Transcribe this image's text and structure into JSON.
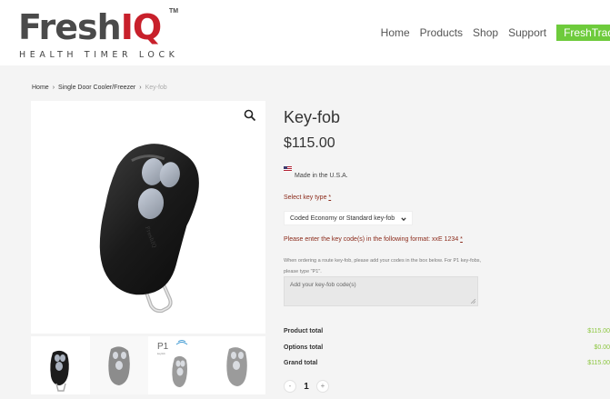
{
  "header": {
    "logo": {
      "fresh": "Fresh",
      "iq": "IQ",
      "tm": "TM",
      "tagline": "HEALTH TIMER LOCK"
    },
    "nav": [
      "Home",
      "Products",
      "Shop",
      "Support"
    ],
    "cta": "FreshTraq"
  },
  "breadcrumb": {
    "home": "Home",
    "category": "Single Door Cooler/Freezer",
    "current": "Key-fob",
    "sep": "›"
  },
  "product": {
    "title": "Key-fob",
    "price": "$115.00",
    "made_in": "Made in the U.S.A.",
    "select_label": "Select key type",
    "required_mark": "*",
    "select_value": "Coded Economy or Standard key-fob",
    "codes_label": "Please enter the key code(s) in the following format: xxE 1234",
    "help_text": "When ordering a route key-fob, please add your codes in the box below. For P1 key-fobs, please type \"P1\".",
    "textarea_placeholder": "Add your key-fob code(s)",
    "thumb_p1_label": "P1",
    "thumb_p1_sub": "keyfob"
  },
  "totals": [
    {
      "label": "Product total",
      "value": "$115.00"
    },
    {
      "label": "Options total",
      "value": "$0.00"
    },
    {
      "label": "Grand total",
      "value": "$115.00"
    }
  ],
  "quantity": {
    "minus": "-",
    "value": "1",
    "plus": "+"
  },
  "colors": {
    "brand_red": "#c8202b",
    "cta_green": "#6ecb3c",
    "price_green": "#8cc63f",
    "label_red": "#8b2a1a"
  }
}
